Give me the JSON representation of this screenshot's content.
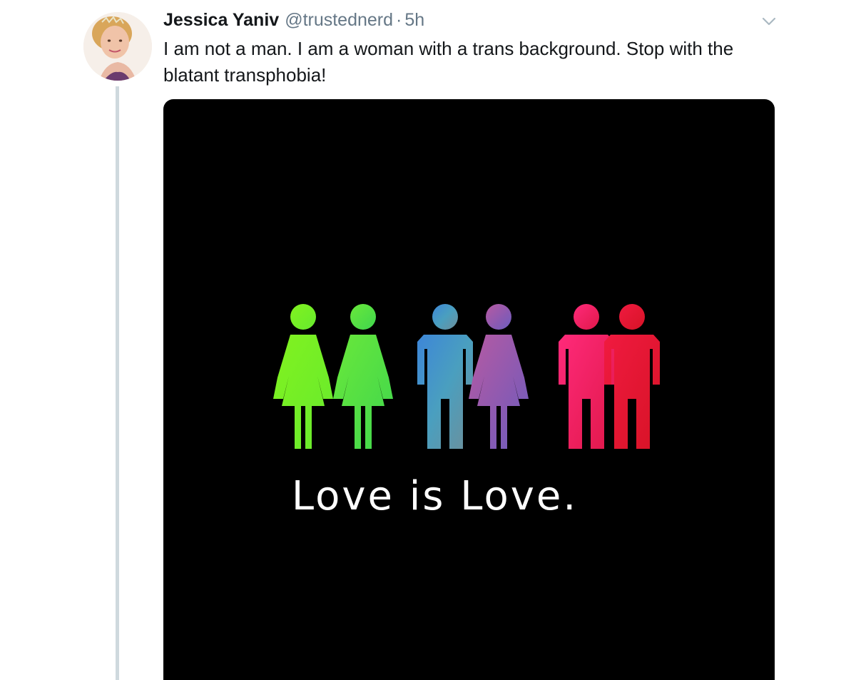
{
  "tweet": {
    "display_name": "Jessica Yaniv",
    "handle": "@trustednerd",
    "separator": "·",
    "time": "5h",
    "text": "I am not a man. I am a woman with a trans background. Stop with the blatant transphobia!",
    "avatar_icon": "profile-photo",
    "menu_icon": "chevron-down-icon"
  },
  "media": {
    "caption": "Love is Love.",
    "background": "#000000",
    "figure_colors": {
      "green_pair": [
        "#7cf22a",
        "#4fdc4a"
      ],
      "blue_pink_pair": [
        "#3f8ed6",
        "#b5549e"
      ],
      "red_pair": [
        "#ff1d6a",
        "#e3162c"
      ]
    }
  },
  "colors": {
    "name": "#14171a",
    "meta": "#657786",
    "thread_line": "#cfd9de"
  }
}
